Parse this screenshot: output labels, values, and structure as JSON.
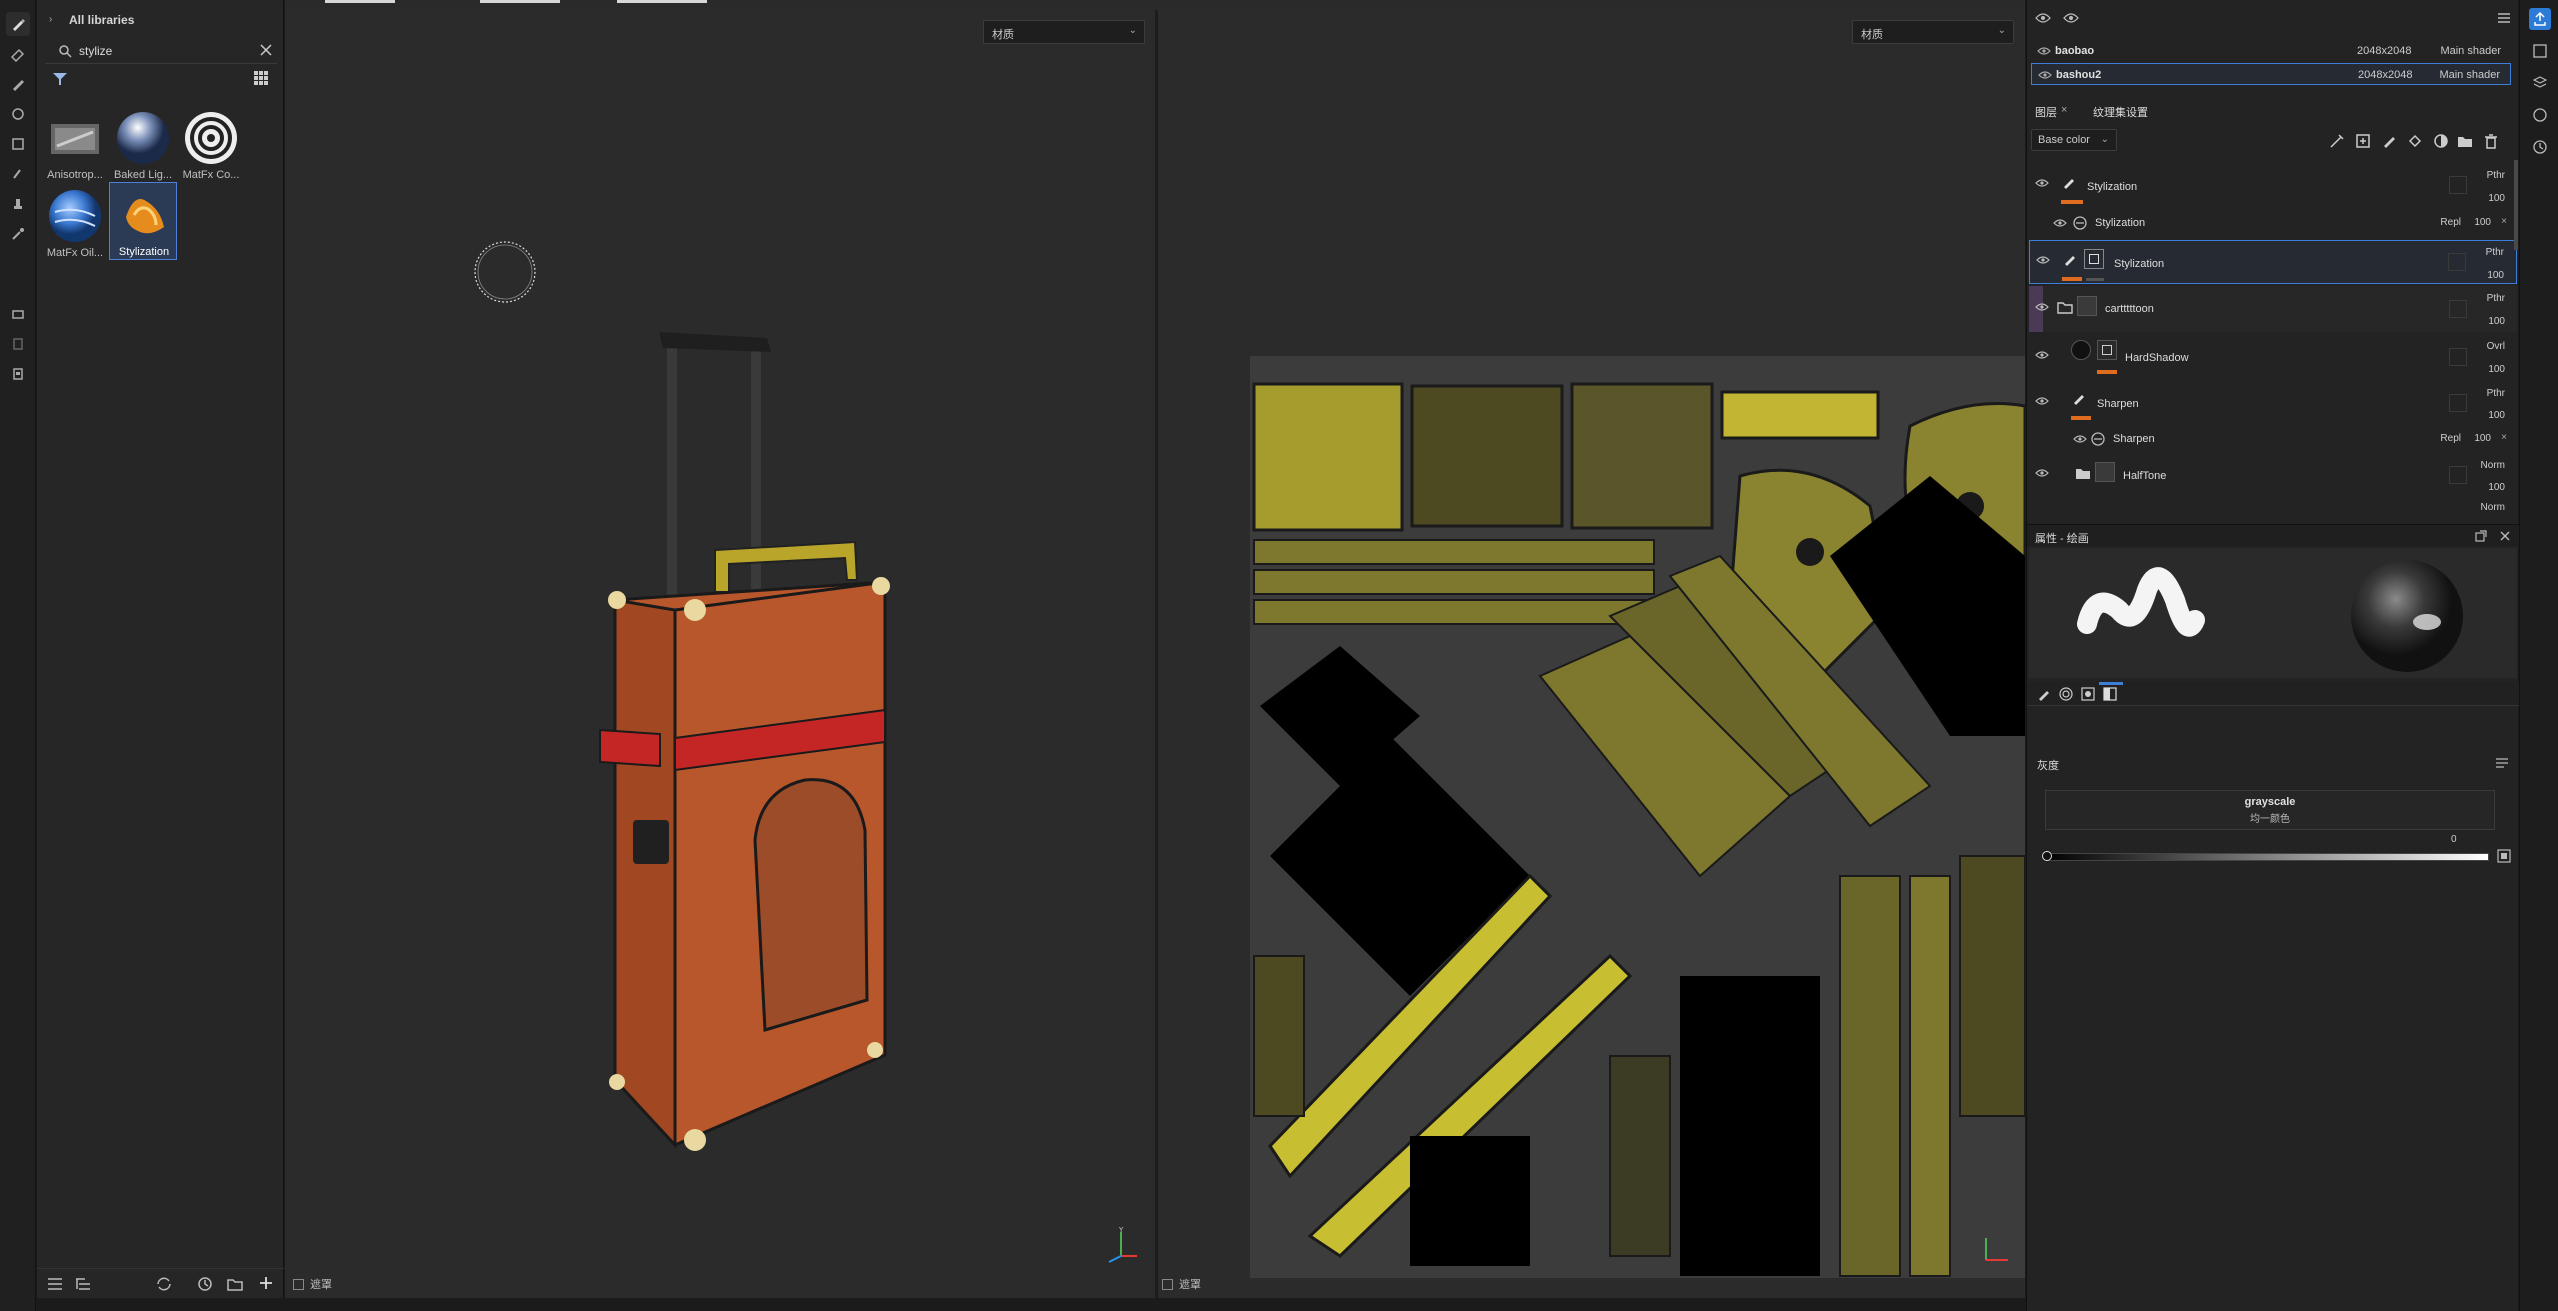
{
  "shelf": {
    "breadcrumb": "All libraries",
    "search_value": "stylize",
    "items": [
      {
        "label": "Anisotrop...",
        "icon": "anisotropic-thumb"
      },
      {
        "label": "Baked Lig...",
        "icon": "baked-light-thumb"
      },
      {
        "label": "MatFx Co...",
        "icon": "matfx-contour-thumb"
      },
      {
        "label": "MatFx Oil...",
        "icon": "matfx-oil-thumb"
      },
      {
        "label": "Stylization",
        "icon": "stylization-thumb",
        "selected": true
      }
    ]
  },
  "viewport3d": {
    "material_dropdown": "材质",
    "footer_label": "遮罩"
  },
  "viewport2d": {
    "material_dropdown": "材质",
    "footer_label": "遮罩"
  },
  "texture_sets": [
    {
      "name": "baobao",
      "resolution": "2048x2048",
      "shader": "Main shader",
      "selected": false
    },
    {
      "name": "bashou2",
      "resolution": "2048x2048",
      "shader": "Main shader",
      "selected": true
    }
  ],
  "layers_panel": {
    "tab_layers": "图层",
    "tab_texture_settings": "纹理集设置",
    "channel_dropdown": "Base color",
    "layers": [
      {
        "name": "Stylization",
        "blend": "Pthr",
        "opacity": "100",
        "kind": "paint"
      },
      {
        "name": "Stylization",
        "blend": "Repl",
        "opacity": "100",
        "kind": "filter-effect"
      },
      {
        "name": "Stylization",
        "blend": "Pthr",
        "opacity": "100",
        "kind": "paint",
        "selected": true
      },
      {
        "name": "cartttttoon",
        "blend": "Pthr",
        "opacity": "100",
        "kind": "folder"
      },
      {
        "name": "HardShadow",
        "blend": "Ovrl",
        "opacity": "100",
        "kind": "fill"
      },
      {
        "name": "Sharpen",
        "blend": "Pthr",
        "opacity": "100",
        "kind": "paint"
      },
      {
        "name": "Sharpen",
        "blend": "Repl",
        "opacity": "100",
        "kind": "filter-effect"
      },
      {
        "name": "HalfTone",
        "blend": "Norm",
        "opacity": "100",
        "kind": "folder"
      }
    ],
    "partial_row_blend": "Norm"
  },
  "properties": {
    "title": "属性 - 绘画",
    "section_grayscale": "灰度",
    "grayscale_name": "grayscale",
    "grayscale_sub": "均一颜色",
    "slider_value": "0",
    "slider_fraction": 0
  },
  "colors": {
    "accent": "#3d7ed8",
    "orange": "#e06d1f",
    "suitcase": "#b8572b",
    "strap": "#c42626",
    "uv_yellow": "#8a8430"
  }
}
